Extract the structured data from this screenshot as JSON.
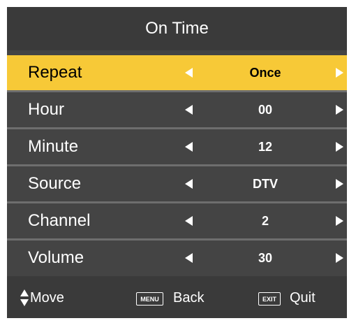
{
  "title": "On Time",
  "selected_color": "#f7c937",
  "rows": [
    {
      "label": "Repeat",
      "value": "Once"
    },
    {
      "label": "Hour",
      "value": "00"
    },
    {
      "label": "Minute",
      "value": "12"
    },
    {
      "label": "Source",
      "value": "DTV"
    },
    {
      "label": "Channel",
      "value": "2"
    },
    {
      "label": "Volume",
      "value": "30"
    }
  ],
  "footer": {
    "move_icon": "up-down-arrow-icon",
    "move_label": "Move",
    "menu_key": "MENU",
    "back_label": "Back",
    "exit_key": "EXIT",
    "quit_label": "Quit"
  }
}
